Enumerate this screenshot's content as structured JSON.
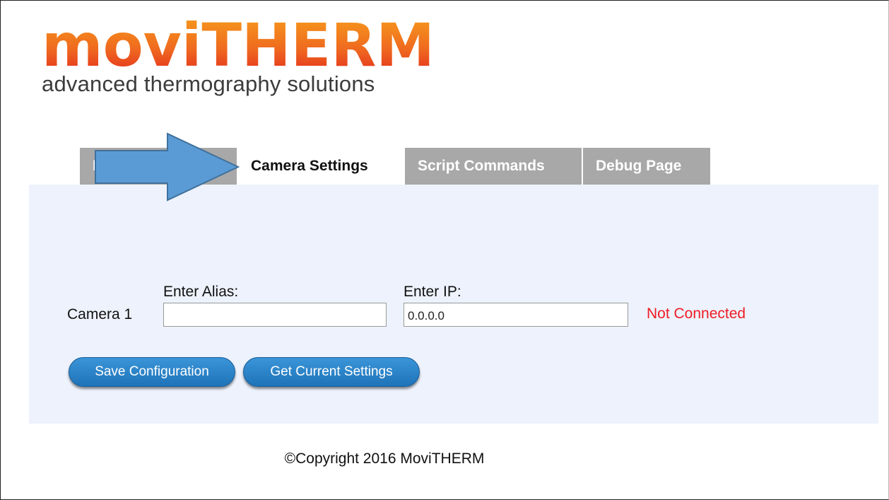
{
  "logo": {
    "word": "moviTHERM",
    "tagline": "advanced thermography solutions"
  },
  "tabs": [
    {
      "label": "Network Settings",
      "active": false
    },
    {
      "label": "Camera Settings",
      "active": true
    },
    {
      "label": "Script Commands",
      "active": false
    },
    {
      "label": "Debug Page",
      "active": false
    }
  ],
  "form": {
    "alias_label": "Enter Alias:",
    "ip_label": "Enter IP:",
    "camera_label": "Camera 1",
    "alias_value": "",
    "ip_value": "0.0.0.0",
    "status": "Not Connected"
  },
  "buttons": {
    "save": "Save Configuration",
    "get": "Get Current Settings"
  },
  "footer": "©Copyright 2016 MoviTHERM",
  "colors": {
    "logo_gradient_top": "#f7a11c",
    "logo_gradient_bottom": "#e2241e",
    "tab_inactive": "#a8a8a8",
    "panel_bg": "#edf2fc",
    "button_blue": "#2a84c8",
    "status_red": "#ee1c24",
    "arrow_blue": "#5b9bd5"
  }
}
